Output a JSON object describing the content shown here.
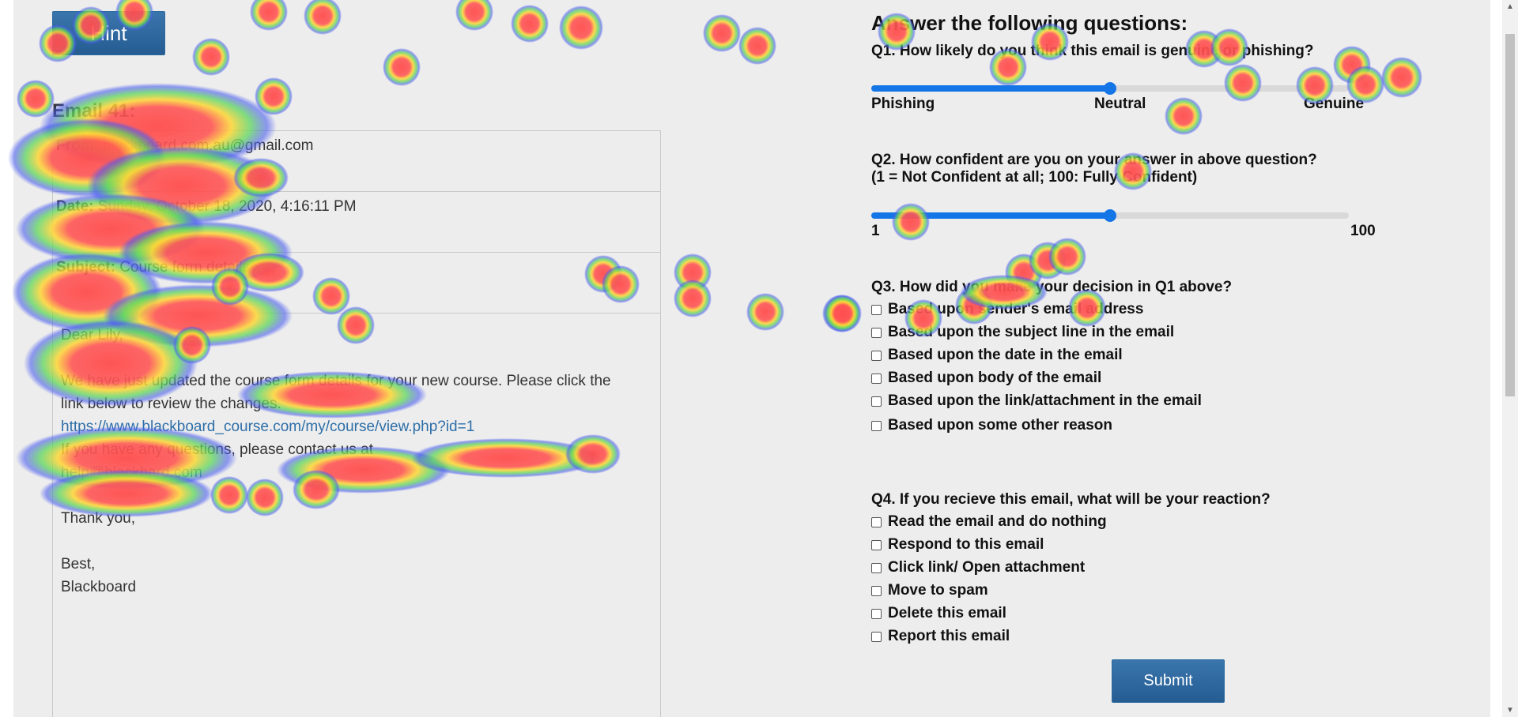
{
  "hint_label": "Hint",
  "email": {
    "title": "Email 41:",
    "from_label": "From:",
    "from_value": "blackboard.com.au@gmail.com",
    "date_label": "Date:",
    "date_value": "Sunday, October 18, 2020, 4:16:11 PM",
    "subject_label": "Subject:",
    "subject_value": "Course form details",
    "greeting": "Dear Lily,",
    "body_line1": "We have just updated the course form details for your new course. Please click the",
    "body_line2": "link below to review the changes.",
    "link": "https://www.blackboard_course.com/my/course/view.php?id=1",
    "body_line3": "If you have any questions, please contact us at",
    "contact_email": "help@blackbard.com",
    "thanks": "Thank you,",
    "closing": "Best,",
    "signature": "Blackboard"
  },
  "questions": {
    "heading": "Answer the following questions:",
    "q1": "Q1. How likely do you think this email is genuine or phishing?",
    "q1_ticks": [
      "Phishing",
      "Neutral",
      "Genuine"
    ],
    "q1_value": 0.5,
    "q2_line1": "Q2. How confident are you on your answer in above question?",
    "q2_line2": "(1 = Not Confident at all; 100: Fully Confident)",
    "q2_min": "1",
    "q2_max": "100",
    "q2_value": 0.5,
    "q3": "Q3. How did you make your decision in Q1 above?",
    "q3_options": [
      "Based upon sender's email address",
      "Based upon the subject line in the email",
      "Based upon the date in the email",
      "Based upon body of the email",
      "Based upon the link/attachment in the email",
      "Based upon some other reason"
    ],
    "q4": "Q4. If you recieve this email, what will be your reaction?",
    "q4_options": [
      "Read the email and do nothing",
      "Respond to this email",
      "Click link/ Open attachment",
      "Move to spam",
      "Delete this email",
      "Report this email"
    ],
    "submit_label": "Submit"
  },
  "colors": {
    "button": "#2b6a9f",
    "slider": "#1476e6",
    "link": "#2d6ea8",
    "page_bg": "#ededed"
  }
}
